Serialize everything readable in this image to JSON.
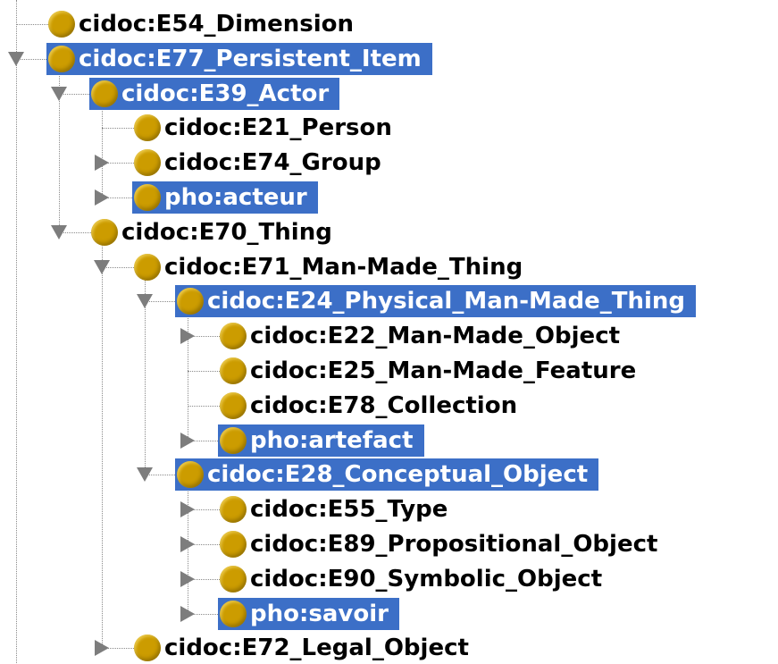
{
  "tree": {
    "nodes": [
      {
        "label": "cidoc:E54_Dimension",
        "depth": 1,
        "toggle": "none",
        "selected": false
      },
      {
        "label": "cidoc:E77_Persistent_Item",
        "depth": 1,
        "toggle": "expanded",
        "selected": true
      },
      {
        "label": "cidoc:E39_Actor",
        "depth": 2,
        "toggle": "expanded",
        "selected": true
      },
      {
        "label": "cidoc:E21_Person",
        "depth": 3,
        "toggle": "none",
        "selected": false
      },
      {
        "label": "cidoc:E74_Group",
        "depth": 3,
        "toggle": "collapsed",
        "selected": false
      },
      {
        "label": "pho:acteur",
        "depth": 3,
        "toggle": "collapsed",
        "selected": true
      },
      {
        "label": "cidoc:E70_Thing",
        "depth": 2,
        "toggle": "expanded",
        "selected": false
      },
      {
        "label": "cidoc:E71_Man-Made_Thing",
        "depth": 3,
        "toggle": "expanded",
        "selected": false
      },
      {
        "label": "cidoc:E24_Physical_Man-Made_Thing",
        "depth": 4,
        "toggle": "expanded",
        "selected": true
      },
      {
        "label": "cidoc:E22_Man-Made_Object",
        "depth": 5,
        "toggle": "collapsed",
        "selected": false
      },
      {
        "label": "cidoc:E25_Man-Made_Feature",
        "depth": 5,
        "toggle": "none",
        "selected": false
      },
      {
        "label": "cidoc:E78_Collection",
        "depth": 5,
        "toggle": "none",
        "selected": false
      },
      {
        "label": "pho:artefact",
        "depth": 5,
        "toggle": "collapsed",
        "selected": true
      },
      {
        "label": "cidoc:E28_Conceptual_Object",
        "depth": 4,
        "toggle": "expanded",
        "selected": true
      },
      {
        "label": "cidoc:E55_Type",
        "depth": 5,
        "toggle": "collapsed",
        "selected": false
      },
      {
        "label": "cidoc:E89_Propositional_Object",
        "depth": 5,
        "toggle": "collapsed",
        "selected": false
      },
      {
        "label": "cidoc:E90_Symbolic_Object",
        "depth": 5,
        "toggle": "collapsed",
        "selected": false
      },
      {
        "label": "pho:savoir",
        "depth": 5,
        "toggle": "collapsed",
        "selected": true
      },
      {
        "label": "cidoc:E72_Legal_Object",
        "depth": 3,
        "toggle": "collapsed",
        "selected": false
      }
    ]
  },
  "colors": {
    "selection": "#3c6fc7",
    "node_dot": "#cc9c00",
    "triangle": "#7d7d7d"
  },
  "icons": {
    "node": "class-node-dot-icon",
    "expanded": "triangle-down-icon",
    "collapsed": "triangle-right-icon"
  }
}
